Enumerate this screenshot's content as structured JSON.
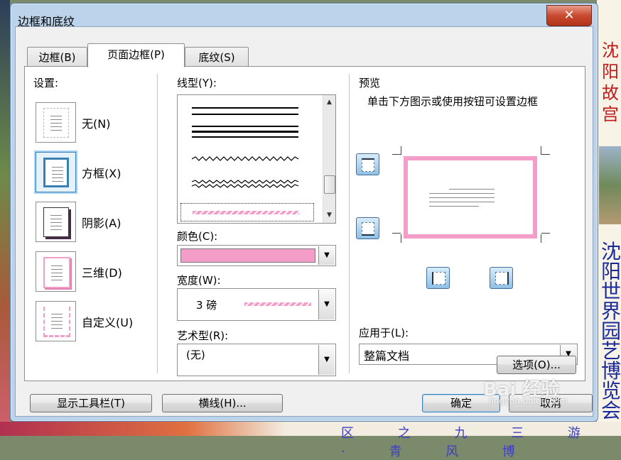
{
  "window": {
    "title": "边框和底纹",
    "close_glyph": "✕"
  },
  "tabs": [
    {
      "label": "边框(B)"
    },
    {
      "label": "页面边框(P)"
    },
    {
      "label": "底纹(S)"
    }
  ],
  "settings": {
    "label": "设置:",
    "items": [
      {
        "label": "无(N)"
      },
      {
        "label": "方框(X)"
      },
      {
        "label": "阴影(A)"
      },
      {
        "label": "三维(D)"
      },
      {
        "label": "自定义(U)"
      }
    ],
    "selected": "方框(X)"
  },
  "line_style": {
    "label": "线型(Y):"
  },
  "color": {
    "label": "颜色(C):",
    "value": "#f59dc9"
  },
  "width": {
    "label": "宽度(W):",
    "value": "3 磅"
  },
  "art": {
    "label": "艺术型(R):",
    "value": "(无)"
  },
  "preview": {
    "label": "预览",
    "hint": "单击下方图示或使用按钮可设置边框"
  },
  "apply_to": {
    "label": "应用于(L):",
    "value": "整篇文档"
  },
  "buttons": {
    "options": "选项(O)...",
    "toolbar": "显示工具栏(T)",
    "hline": "横线(H)...",
    "ok": "确定",
    "cancel": "取消"
  },
  "background": {
    "glyphs_red": [
      "沈",
      "阳",
      "故",
      "宫"
    ],
    "glyphs_blue": [
      "沈",
      "阳",
      "世",
      "界",
      "园",
      "艺",
      "博",
      "览",
      "会"
    ],
    "bottom_text": "区 之 九 三 游 · 青 风 博"
  },
  "watermark": {
    "main": "Bai 经验",
    "sub": "jingyan.baidu.com"
  },
  "colors": {
    "accent_pink": "#f59dc9",
    "selection_blue": "#3c7fb1"
  }
}
